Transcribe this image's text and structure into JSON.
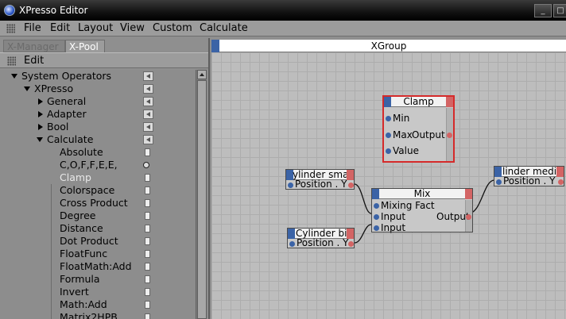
{
  "window": {
    "title": "XPresso Editor",
    "minimize": "_",
    "maximize": "□"
  },
  "menu": [
    "File",
    "Edit",
    "Layout",
    "View",
    "Custom",
    "Calculate"
  ],
  "tabs": {
    "xmanager": "X-Manager",
    "xpool": "X-Pool"
  },
  "panel_menu": {
    "edit": "Edit"
  },
  "tree": {
    "system_operators": "System Operators",
    "xpresso": "XPresso",
    "general": "General",
    "adapter": "Adapter",
    "bool": "Bool",
    "calculate": "Calculate",
    "items": [
      "Absolute",
      "C,O,F,F,E,E,",
      "Clamp",
      "Colorspace",
      "Cross Product",
      "Degree",
      "Distance",
      "Dot Product",
      "FloatFunc",
      "FloatMath:Add",
      "Formula",
      "Invert",
      "Math:Add",
      "Matrix2HPB"
    ],
    "selected": "Clamp"
  },
  "canvas": {
    "group_title": "XGroup",
    "nodes": {
      "clamp": {
        "title": "Clamp",
        "ports_in": [
          "Min",
          "Max",
          "Value"
        ],
        "port_out": "Output"
      },
      "cyl_small": {
        "title": "ylinder sma",
        "port_out": "Position . Y"
      },
      "mix": {
        "title": "Mix",
        "ports_in": [
          "Mixing Fact",
          "Input",
          "Input"
        ],
        "port_out": "Output"
      },
      "cyl_big": {
        "title": "Cylinder big",
        "port_out": "Position . Y"
      },
      "cyl_medium": {
        "title": "linder mediu",
        "port_out": "Position . Y"
      }
    }
  },
  "colors": {
    "input_port": "#3b63a6",
    "output_port": "#d36464",
    "selection": "#d52a2a"
  }
}
